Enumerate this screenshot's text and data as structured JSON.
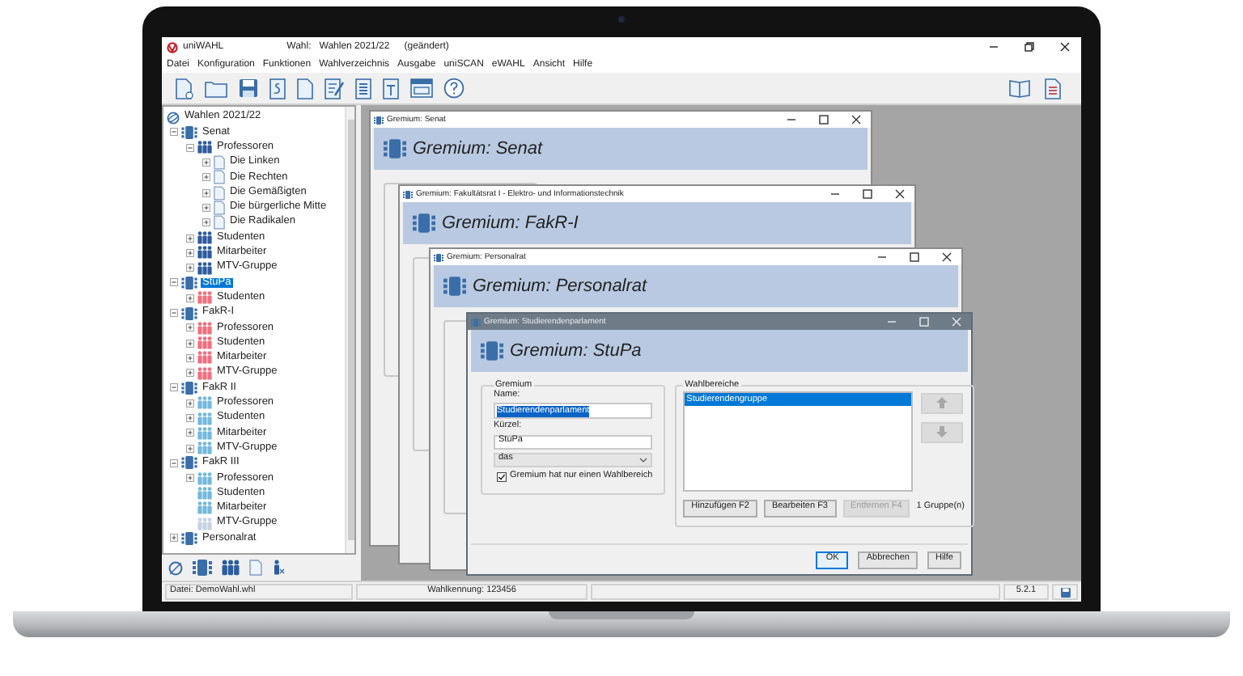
{
  "app": {
    "title": "uniWAHL",
    "election_label": "Wahl:",
    "election": "Wahlen 2021/22",
    "modified": "(geändert)"
  },
  "menu": [
    "Datei",
    "Konfiguration",
    "Funktionen",
    "Wahlverzeichnis",
    "Ausgabe",
    "uniSCAN",
    "eWAHL",
    "Ansicht",
    "Hilfe"
  ],
  "tree": {
    "label": "Wahlen 2021/22",
    "children": [
      {
        "label": "Senat",
        "kind": "body",
        "expanded": true,
        "selected": false,
        "children": [
          {
            "label": "Professoren",
            "kind": "group",
            "color": "#2d5c9e",
            "expanded": true,
            "selected": false,
            "children": [
              {
                "label": "Die Linken",
                "kind": "list",
                "expanded": false,
                "selected": false
              },
              {
                "label": "Die Rechten",
                "kind": "list",
                "expanded": false,
                "selected": false
              },
              {
                "label": "Die Gemäßigten",
                "kind": "list",
                "expanded": false,
                "selected": false
              },
              {
                "label": "Die bürgerliche Mitte",
                "kind": "list",
                "expanded": false,
                "selected": false
              },
              {
                "label": "Die Radikalen",
                "kind": "list",
                "expanded": false,
                "selected": false
              }
            ]
          },
          {
            "label": "Studenten",
            "kind": "group",
            "color": "#2d5c9e",
            "expanded": false,
            "selected": false
          },
          {
            "label": "Mitarbeiter",
            "kind": "group",
            "color": "#2d5c9e",
            "expanded": false,
            "selected": false
          },
          {
            "label": "MTV-Gruppe",
            "kind": "group",
            "color": "#2d5c9e",
            "expanded": false,
            "selected": false
          }
        ]
      },
      {
        "label": "StuPa",
        "kind": "body",
        "expanded": true,
        "selected": true,
        "children": [
          {
            "label": "Studenten",
            "kind": "group",
            "color": "#f0707f",
            "expanded": false,
            "selected": false
          }
        ]
      },
      {
        "label": "FakR-I",
        "kind": "body",
        "expanded": true,
        "selected": false,
        "children": [
          {
            "label": "Professoren",
            "kind": "group",
            "color": "#f0707f",
            "expanded": false,
            "selected": false
          },
          {
            "label": "Studenten",
            "kind": "group",
            "color": "#f0707f",
            "expanded": false,
            "selected": false
          },
          {
            "label": "Mitarbeiter",
            "kind": "group",
            "color": "#f0707f",
            "expanded": false,
            "selected": false
          },
          {
            "label": "MTV-Gruppe",
            "kind": "group",
            "color": "#f0707f",
            "expanded": false,
            "selected": false
          }
        ]
      },
      {
        "label": "FakR II",
        "kind": "body",
        "expanded": true,
        "selected": false,
        "children": [
          {
            "label": "Professoren",
            "kind": "group",
            "color": "#74b9dc",
            "expanded": false,
            "selected": false
          },
          {
            "label": "Studenten",
            "kind": "group",
            "color": "#74b9dc",
            "expanded": false,
            "selected": false
          },
          {
            "label": "Mitarbeiter",
            "kind": "group",
            "color": "#74b9dc",
            "expanded": false,
            "selected": false
          },
          {
            "label": "MTV-Gruppe",
            "kind": "group",
            "color": "#74b9dc",
            "expanded": false,
            "selected": false
          }
        ]
      },
      {
        "label": "FakR III",
        "kind": "body",
        "expanded": true,
        "selected": false,
        "children": [
          {
            "label": "Professoren",
            "kind": "group",
            "color": "#74b9dc",
            "expanded": false,
            "selected": false
          },
          {
            "label": "Studenten",
            "kind": "group",
            "color": "#74b9dc",
            "selected": false
          },
          {
            "label": "Mitarbeiter",
            "kind": "group",
            "color": "#74b9dc",
            "selected": false
          },
          {
            "label": "MTV-Gruppe",
            "kind": "group",
            "color": "#c5d3e3",
            "selected": false
          }
        ]
      },
      {
        "label": "Personalrat",
        "kind": "body",
        "expanded": false,
        "selected": false
      }
    ]
  },
  "windows": [
    {
      "title": "Gremium: Senat",
      "heading": "Gremium: Senat",
      "active": false
    },
    {
      "title": "Gremium: Fakultätsrat I - Elektro- und Informationstechnik",
      "heading": "Gremium: FakR-I",
      "active": false
    },
    {
      "title": "Gremium: Personalrat",
      "heading": "Gremium: Personalrat",
      "active": false
    },
    {
      "title": "Gremium: Studierendenparlament",
      "heading": "Gremium: StuPa",
      "active": true,
      "form": {
        "group_title": "Gremium",
        "name_label": "Name:",
        "name_value": "Studierendenparlament",
        "name_text_selected": true,
        "short_label": "Kürzel:",
        "short_value": "StuPa",
        "article": "das",
        "single_area": {
          "label": "Gremium hat nur einen Wahlbereich",
          "checked": true
        },
        "areas_title": "Wahlbereiche",
        "areas": [
          {
            "label": "Studierendengruppe",
            "selected": true
          }
        ],
        "move_buttons": [
          {
            "kind": "up",
            "disabled": true
          },
          {
            "kind": "down",
            "disabled": true
          }
        ],
        "area_buttons": [
          {
            "label": "Hinzufügen F2",
            "disabled": false
          },
          {
            "label": "Bearbeiten F3",
            "disabled": false
          },
          {
            "label": "Entfernen F4",
            "disabled": true
          }
        ],
        "count": "1 Gruppe(n)",
        "buttons": [
          {
            "label": "OK",
            "default": true
          },
          {
            "label": "Abbrechen",
            "default": false
          },
          {
            "label": "Hilfe",
            "default": false
          }
        ]
      }
    }
  ],
  "status_bar": {
    "file": "Datei: DemoWahl.whl",
    "election_id": "Wahlkennung: 123456",
    "version": "5.2.1"
  }
}
